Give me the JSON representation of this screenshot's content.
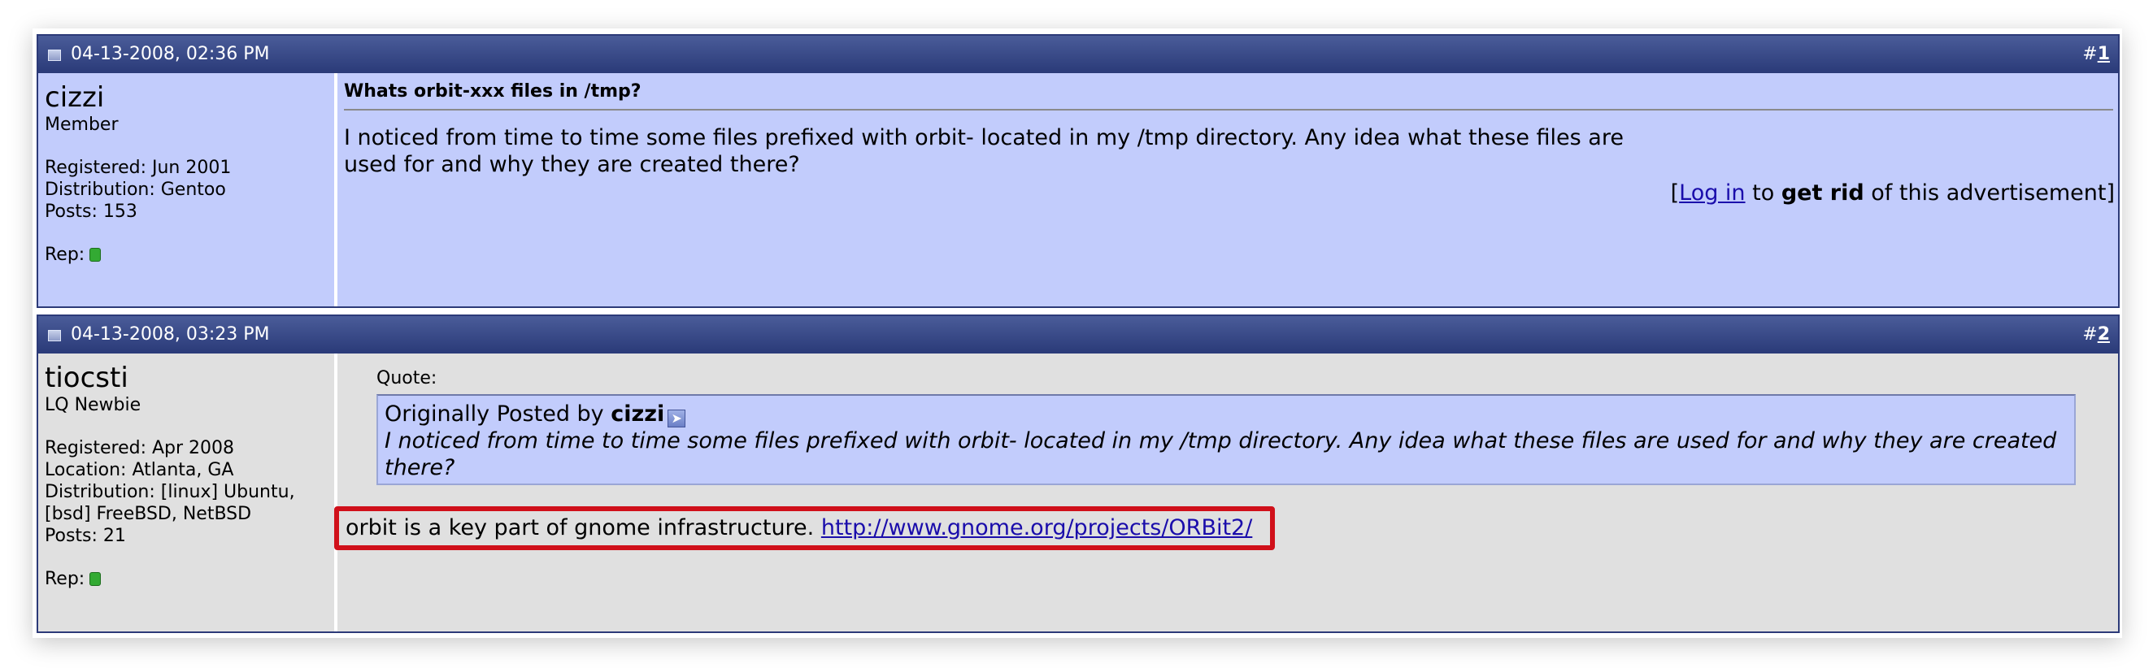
{
  "posts": [
    {
      "date": "04-13-2008, 02:36 PM",
      "number_prefix": "#",
      "number": "1",
      "user": {
        "name": "cizzi",
        "title": "Member",
        "stats": [
          "Registered: Jun 2001",
          "Distribution: Gentoo",
          "Posts: 153"
        ],
        "rep_label": "Rep:"
      },
      "title": "Whats orbit-xxx files in /tmp?",
      "message": "I noticed from time to time some files prefixed with orbit- located in my /tmp directory. Any idea what these files are used for and why they are created there?",
      "ad": {
        "open": "[",
        "login_link": "Log in",
        "to": " to ",
        "get_rid": "get rid",
        "rest": " of this advertisement]"
      }
    },
    {
      "date": "04-13-2008, 03:23 PM",
      "number_prefix": "#",
      "number": "2",
      "user": {
        "name": "tiocsti",
        "title": "LQ Newbie",
        "stats": [
          "Registered: Apr 2008",
          "Location: Atlanta, GA",
          "Distribution: [linux] Ubuntu,",
          "[bsd] FreeBSD, NetBSD",
          "Posts: 21"
        ],
        "rep_label": "Rep:"
      },
      "quote": {
        "label": "Quote:",
        "posted_by_prefix": "Originally Posted by ",
        "author": "cizzi",
        "text": "I noticed from time to time some files prefixed with orbit- located in my /tmp directory. Any idea what these files are used for and why they are created there?"
      },
      "reply_text": "orbit is a key part of gnome infrastructure. ",
      "reply_link": "http://www.gnome.org/projects/ORBit2/"
    }
  ],
  "colors": {
    "header_gradient_top": "#4a5c99",
    "header_gradient_bottom": "#2a3a78",
    "post1_bg": "#c2ccfc",
    "post2_bg": "#e0e0e0",
    "highlight_box": "#d0101a",
    "link": "#1a0dab"
  },
  "icons": [
    "post-icon",
    "view-post-icon",
    "reputation-icon"
  ]
}
